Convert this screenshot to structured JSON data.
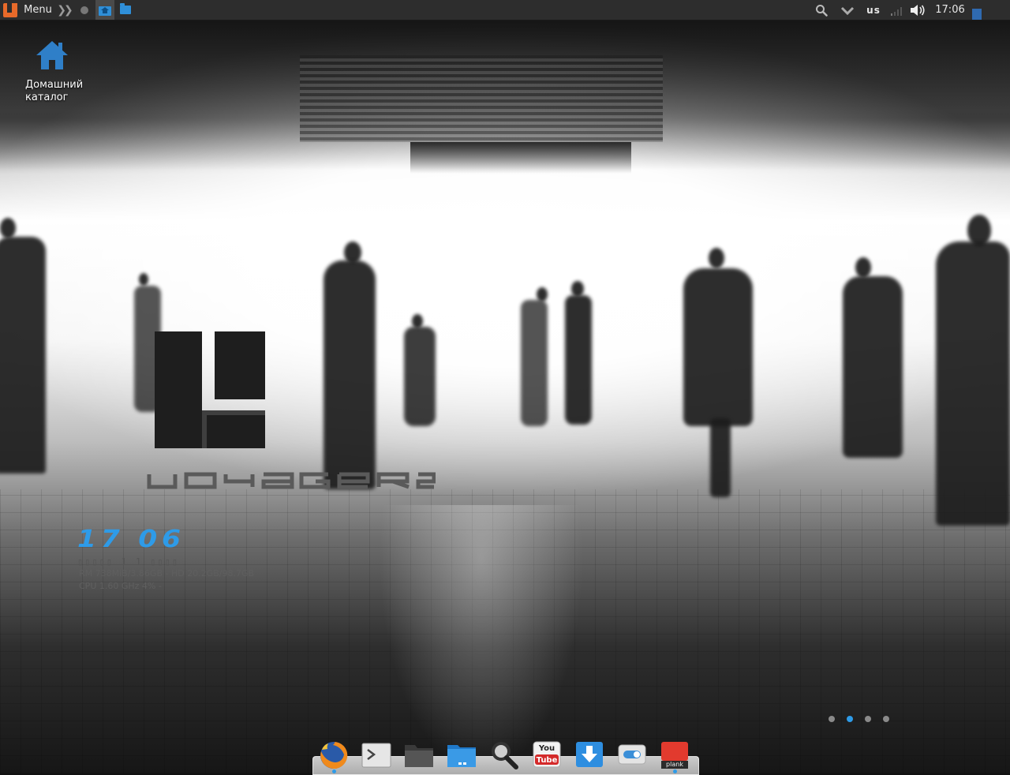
{
  "top_panel": {
    "menu_label": "Menu",
    "keyboard_layout": "us",
    "clock": "17:06"
  },
  "desktop": {
    "icons": [
      {
        "label": "Домашний каталог",
        "icon": "home-folder-icon"
      }
    ]
  },
  "logo": {
    "wordmark": "Voyager"
  },
  "conky": {
    "time": "17 06",
    "date": "▯▯▯▯▯  1 1  ▯▯▯▯",
    "ram_hd": "RM 738MiB/3.86GB - HD 20.2GB/98.7GB",
    "cpu": "CPU 1.60 GHz 4% -"
  },
  "workspaces": {
    "count": 4,
    "active_index": 1,
    "accent": "#2e9be8"
  },
  "dock": {
    "items": [
      {
        "name": "firefox",
        "icon": "firefox-icon",
        "running": true
      },
      {
        "name": "terminal",
        "icon": "terminal-icon",
        "running": false
      },
      {
        "name": "file-manager",
        "icon": "folder-icon",
        "running": false
      },
      {
        "name": "desktop-folder",
        "icon": "desktop-icon",
        "running": false
      },
      {
        "name": "search",
        "icon": "magnifier-icon",
        "running": false
      },
      {
        "name": "youtube",
        "icon": "youtube-icon",
        "label_top": "You",
        "label_bottom": "Tube",
        "running": false
      },
      {
        "name": "downloader",
        "icon": "download-icon",
        "running": false
      },
      {
        "name": "settings-toggle",
        "icon": "toggle-icon",
        "running": false
      },
      {
        "name": "plank",
        "icon": "plank-icon",
        "label": "plank",
        "running": true
      }
    ]
  }
}
